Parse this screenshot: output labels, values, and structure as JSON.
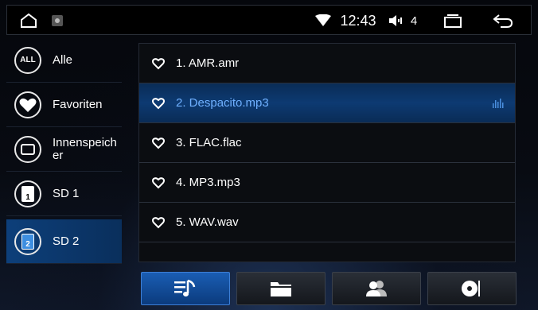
{
  "status_bar": {
    "time": "12:43",
    "volume": "4",
    "icons": [
      "home-icon",
      "app-thumbnail-icon",
      "wifi-icon",
      "volume-icon",
      "recent-apps-icon",
      "back-icon"
    ]
  },
  "sidebar": {
    "items": [
      {
        "label": "Alle",
        "icon": "all-icon",
        "icon_text": "ALL",
        "active": false
      },
      {
        "label": "Favoriten",
        "icon": "heart-icon",
        "active": false
      },
      {
        "label": "Innenspeicher",
        "icon": "internal-storage-icon",
        "active": false
      },
      {
        "label": "SD 1",
        "icon": "sd-card-1-icon",
        "icon_text": "1",
        "active": false
      },
      {
        "label": "SD 2",
        "icon": "sd-card-2-icon",
        "icon_text": "2",
        "active": true
      }
    ]
  },
  "file_list": {
    "items": [
      {
        "label": "1. AMR.amr",
        "active": false
      },
      {
        "label": "2. Despacito.mp3",
        "active": true
      },
      {
        "label": "3. FLAC.flac",
        "active": false
      },
      {
        "label": "4. MP3.mp3",
        "active": false
      },
      {
        "label": "5. WAV.wav",
        "active": false
      }
    ]
  },
  "tabs": [
    {
      "icon": "playlist-icon",
      "active": true
    },
    {
      "icon": "folder-icon",
      "active": false
    },
    {
      "icon": "artist-icon",
      "active": false
    },
    {
      "icon": "album-icon",
      "active": false
    }
  ],
  "colors": {
    "accent": "#0d3f7a",
    "active_text": "#6fb0ff"
  }
}
